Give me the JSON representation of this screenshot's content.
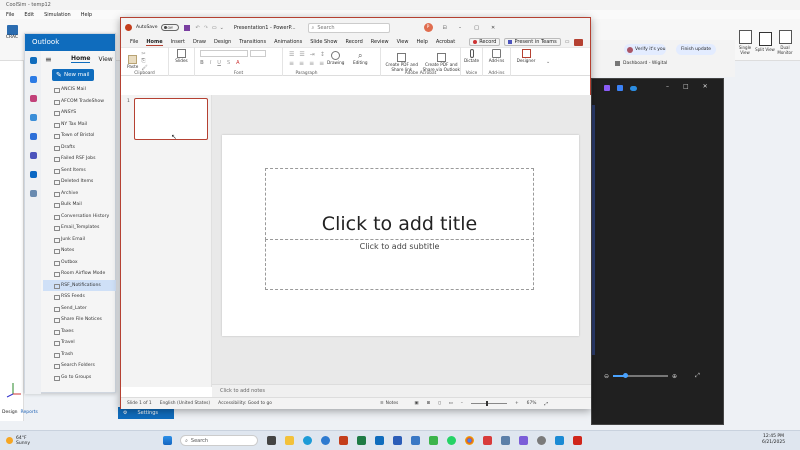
{
  "colors": {
    "outlook_blue": "#0f6cbd",
    "ppt_red": "#b54132",
    "taskbar": "#dfe6ef",
    "dark_window": "#202020"
  },
  "bg_app": {
    "title": "CoolSim - temp12",
    "menu": [
      "File",
      "Edit",
      "Simulation",
      "Help"
    ],
    "left_tool": "CRAC",
    "right_tools": [
      {
        "label": "Single View",
        "icon": "single-view-icon"
      },
      {
        "label": "Split View",
        "icon": "split-view-icon"
      },
      {
        "label": "Dual Monitor",
        "icon": "dual-monitor-icon"
      }
    ],
    "bottom_tabs": [
      "Design",
      "Reports"
    ],
    "settings_label": "Settings"
  },
  "outlook": {
    "app_name": "Outlook",
    "tabs": [
      "Home",
      "View"
    ],
    "new_mail": "New mail",
    "folders": [
      "ANCIS Mail",
      "AFCOM TradeShow",
      "ANSYS",
      "NY Tax Mail",
      "Town of Bristol",
      "Drafts",
      "Failed RSF Jobs",
      "Sent Items",
      "Deleted Items",
      "Archive",
      "Bulk Mail",
      "Conversation History",
      "Email_Templates",
      "Junk Email",
      "Notes",
      "Outbox",
      "Room Airflow Mode",
      "RSF_Notifications",
      "RSS Feeds",
      "Send_Later",
      "Share File Notices",
      "Taxes",
      "Travel",
      "Trash",
      "Search Folders",
      "Go to Groups"
    ],
    "selected_folder": "RSF_Notifications"
  },
  "ppt": {
    "autosave": "AutoSave",
    "autosave_state": "Off",
    "doc_title": "Presentation1 - PowerP...",
    "search_placeholder": "Search",
    "avatar_initials": "P",
    "menu": [
      "File",
      "Home",
      "Insert",
      "Draw",
      "Design",
      "Transitions",
      "Animations",
      "Slide Show",
      "Record",
      "Review",
      "View",
      "Help",
      "Acrobat"
    ],
    "active_tab": "Home",
    "record_btn": "Record",
    "present_btn": "Present in Teams",
    "ribbon": {
      "paste": "Paste",
      "slides": "Slides",
      "drawing": "Drawing",
      "editing": "Editing",
      "create_pdf": "Create PDF and Share link",
      "create_pdf_outlook": "Create PDF and Share via Outlook",
      "dictate": "Dictate",
      "addins": "Add-ins",
      "designer": "Designer",
      "groups": [
        "Clipboard",
        "Font",
        "Paragraph",
        "Adobe Acrobat",
        "Voice",
        "Add-ins"
      ]
    },
    "thumb_number": "1",
    "title_placeholder": "Click to add title",
    "subtitle_placeholder": "Click to add subtitle",
    "notes_placeholder": "Click to add notes",
    "status": {
      "slide": "Slide 1 of 1",
      "language": "English (United States)",
      "accessibility": "Accessibility: Good to go",
      "notes": "Notes",
      "zoom": "67%"
    }
  },
  "browser": {
    "btn1": "Verify it's you",
    "btn2": "Finish update",
    "tab": "Dashboard - Wigital"
  },
  "taskbar": {
    "weather_temp": "64°F",
    "weather_desc": "Sunny",
    "search": "Search",
    "time": "12:45 PM",
    "date": "6/21/2025"
  }
}
